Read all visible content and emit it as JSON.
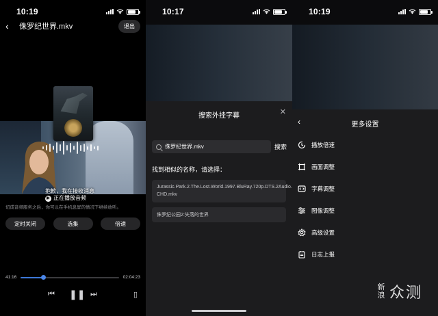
{
  "screens": [
    {
      "status": {
        "time": "10:19"
      },
      "title": "侏罗纪世界.mkv",
      "exit_label": "退出",
      "now_playing": {
        "line1": "抱歉，我在接收消息",
        "line2": "正在播放音频"
      },
      "hint": "切成音频服务之后，你可以在手机息屏的情况下继续收听。",
      "buttons": [
        "定时关闭",
        "选集",
        "倍速"
      ],
      "progress": {
        "current": "41:16",
        "total": "02:04:23",
        "fraction": 0.23
      }
    },
    {
      "status": {
        "time": "10:17"
      },
      "sheet_title": "搜索外挂字幕",
      "search": {
        "value": "侏罗纪世界.mkv",
        "button": "搜索"
      },
      "found_label": "找到相似的名称，请选择：",
      "results": [
        "Jurassic.Park.2.The.Lost.World.1997.BluRay.720p.DTS.2Audio.x264-CHD.mkv",
        "侏罗纪公园2:失落的世界"
      ]
    },
    {
      "status": {
        "time": "10:19"
      },
      "sheet_title": "更多设置",
      "menu": [
        {
          "label": "播放倍速",
          "icon": "speed-icon"
        },
        {
          "label": "画面调整",
          "icon": "frame-icon"
        },
        {
          "label": "字幕调整",
          "icon": "subtitle-icon"
        },
        {
          "label": "图像调整",
          "icon": "sliders-icon"
        },
        {
          "label": "高级设置",
          "icon": "gear-icon"
        },
        {
          "label": "日志上报",
          "icon": "log-icon"
        }
      ]
    }
  ],
  "watermark": {
    "small": "新浪",
    "big": "众测"
  },
  "colors": {
    "accent": "#3d78d8",
    "sheet": "#1c1c1e",
    "pill": "#262628"
  }
}
